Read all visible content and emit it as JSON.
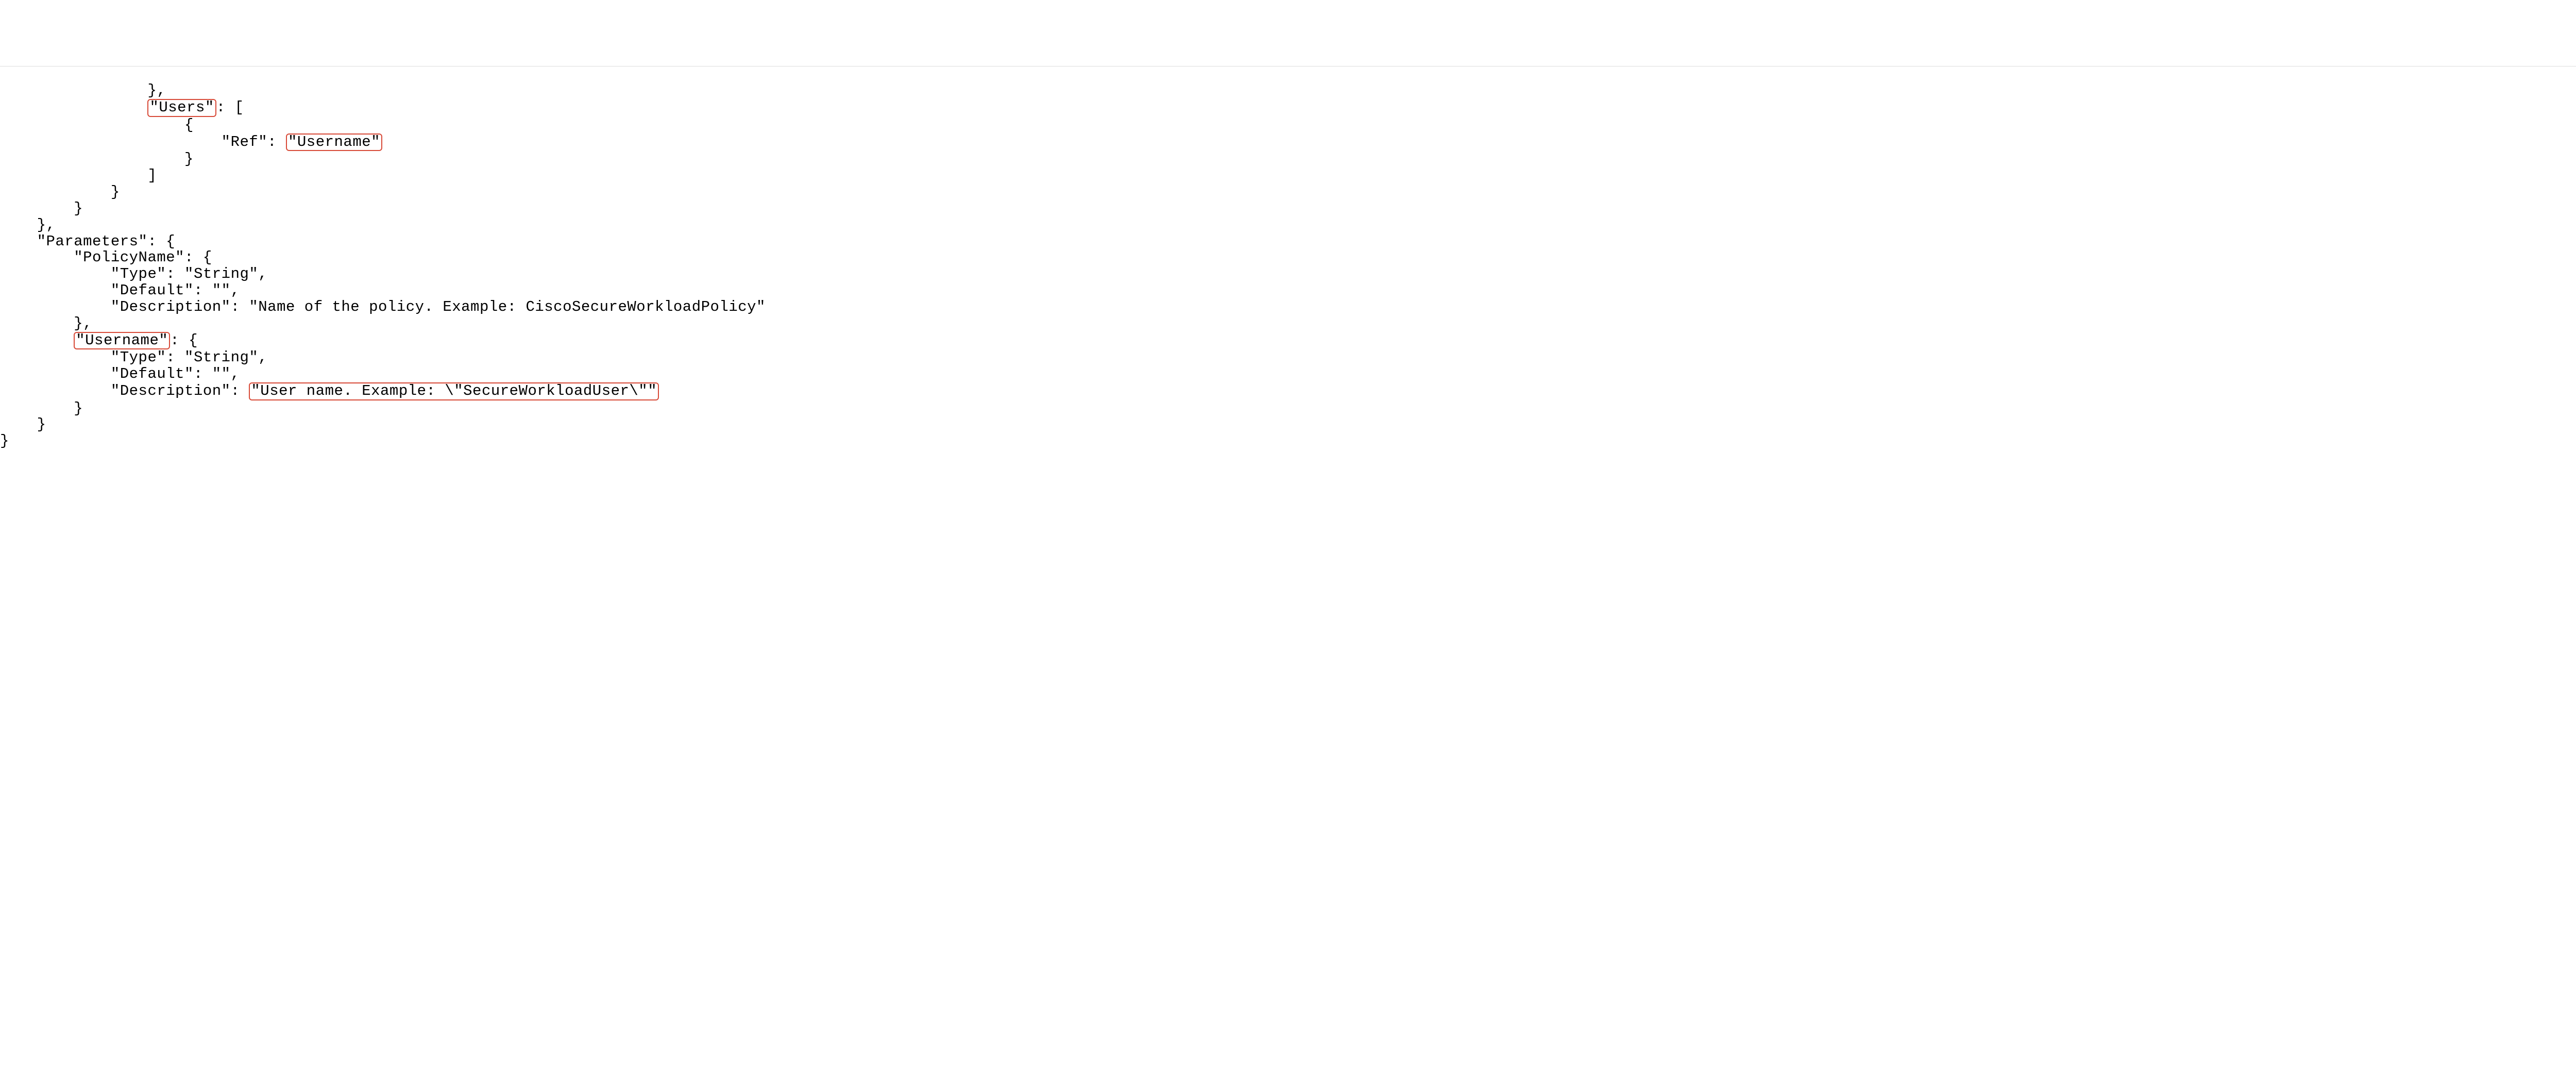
{
  "code": {
    "l1": "                },",
    "l2a": "                ",
    "l2b": "\"Users\"",
    "l2c": ": [",
    "l3": "                    {",
    "l4a": "                        \"Ref\": ",
    "l4b": "\"Username\"",
    "l5": "                    }",
    "l6": "                ]",
    "l7": "            }",
    "l8": "        }",
    "l9": "    },",
    "l10": "    \"Parameters\": {",
    "l11": "        \"PolicyName\": {",
    "l12": "            \"Type\": \"String\",",
    "l13": "            \"Default\": \"\",",
    "l14": "            \"Description\": \"Name of the policy. Example: CiscoSecureWorkloadPolicy\"",
    "l15": "        },",
    "l16a": "        ",
    "l16b": "\"Username\"",
    "l16c": ": {",
    "l17": "            \"Type\": \"String\",",
    "l18": "            \"Default\": \"\",",
    "l19a": "            \"Description\": ",
    "l19b": "\"User name. Example: \\\"SecureWorkloadUser\\\"\"",
    "l20": "        }",
    "l21": "    }",
    "l22": "}"
  }
}
